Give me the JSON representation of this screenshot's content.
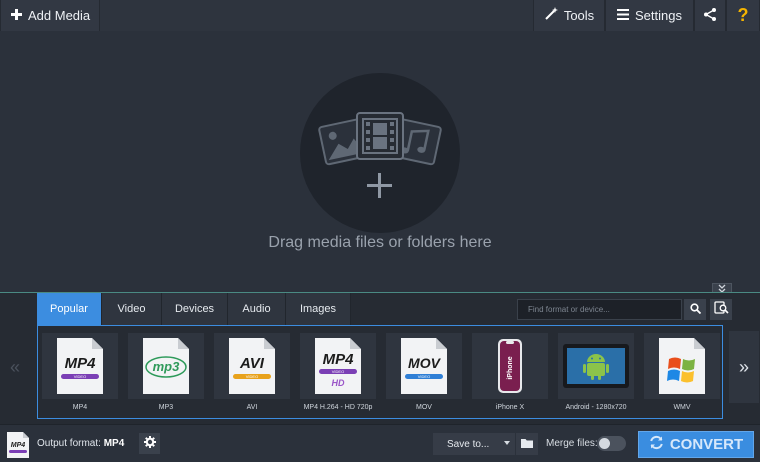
{
  "toolbar": {
    "add_media_label": "Add Media",
    "tools_label": "Tools",
    "settings_label": "Settings",
    "help_label": "?"
  },
  "dropzone": {
    "text": "Drag media files or folders here"
  },
  "formats": {
    "tabs": [
      {
        "label": "Popular",
        "active": true
      },
      {
        "label": "Video",
        "active": false
      },
      {
        "label": "Devices",
        "active": false
      },
      {
        "label": "Audio",
        "active": false
      },
      {
        "label": "Images",
        "active": false
      }
    ],
    "search_placeholder": "Find format or device...",
    "items": [
      {
        "label": "MP4",
        "badge": "MP4",
        "sub": "VIDEO",
        "icon": "mp4-icon"
      },
      {
        "label": "MP3",
        "badge": "mp3",
        "icon": "mp3-icon"
      },
      {
        "label": "AVI",
        "badge": "AVI",
        "sub": "VIDEO",
        "icon": "avi-icon"
      },
      {
        "label": "MP4 H.264 - HD 720p",
        "badge": "MP4",
        "sub": "VIDEO",
        "extra": "HD",
        "icon": "mp4-hd-icon"
      },
      {
        "label": "MOV",
        "badge": "MOV",
        "sub": "VIDEO",
        "icon": "mov-icon"
      },
      {
        "label": "iPhone X",
        "badge": "iPhone",
        "icon": "iphone-icon"
      },
      {
        "label": "Android - 1280x720",
        "icon": "android-icon"
      },
      {
        "label": "WMV",
        "icon": "wmv-icon"
      }
    ]
  },
  "bottom": {
    "output_prefix": "Output format:",
    "output_format": "MP4",
    "save_to_label": "Save to...",
    "merge_label": "Merge files:",
    "merge_enabled": false,
    "convert_label": "CONVERT"
  },
  "colors": {
    "accent": "#3c8de0",
    "background": "#2b313b",
    "help": "#f5b400"
  }
}
